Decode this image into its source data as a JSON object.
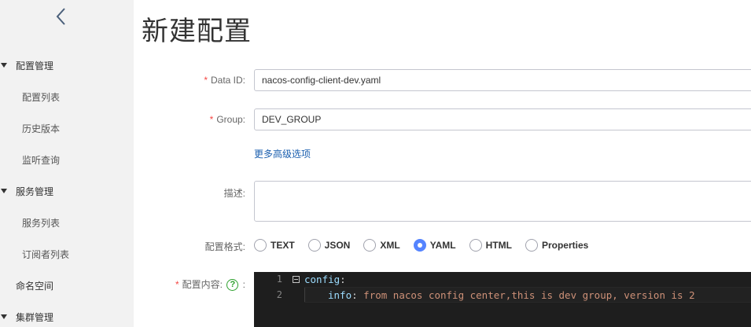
{
  "sidebar": {
    "collapse_icon": "chevron-left-icon",
    "groups": [
      {
        "label": "配置管理",
        "items": [
          "配置列表",
          "历史版本",
          "监听查询"
        ]
      },
      {
        "label": "服务管理",
        "items": [
          "服务列表",
          "订阅者列表"
        ]
      }
    ],
    "namespace_label": "命名空间",
    "cluster_label": "集群管理"
  },
  "page": {
    "title": "新建配置"
  },
  "form": {
    "required_mark": "*",
    "data_id": {
      "label": "Data ID:",
      "value": "nacos-config-client-dev.yaml"
    },
    "group": {
      "label": "Group:",
      "value": "DEV_GROUP"
    },
    "advanced_link": "更多高级选项",
    "description": {
      "label": "描述:",
      "value": ""
    },
    "format": {
      "label": "配置格式:",
      "options": [
        "TEXT",
        "JSON",
        "XML",
        "YAML",
        "HTML",
        "Properties"
      ],
      "selected": "YAML"
    },
    "content": {
      "label": "配置内容:",
      "help_glyph": "?",
      "colon": ":",
      "line_numbers": [
        "1",
        "2"
      ],
      "line1_key": "config",
      "line1_colon": ":",
      "line2_key": "info",
      "line2_colon": ":",
      "line2_value": "from nacos config center,this is dev group, version is 2"
    }
  },
  "colors": {
    "accent": "#5584ff",
    "link": "#1b5faf",
    "required": "#f54743",
    "editor_bg": "#1e1e1e"
  }
}
